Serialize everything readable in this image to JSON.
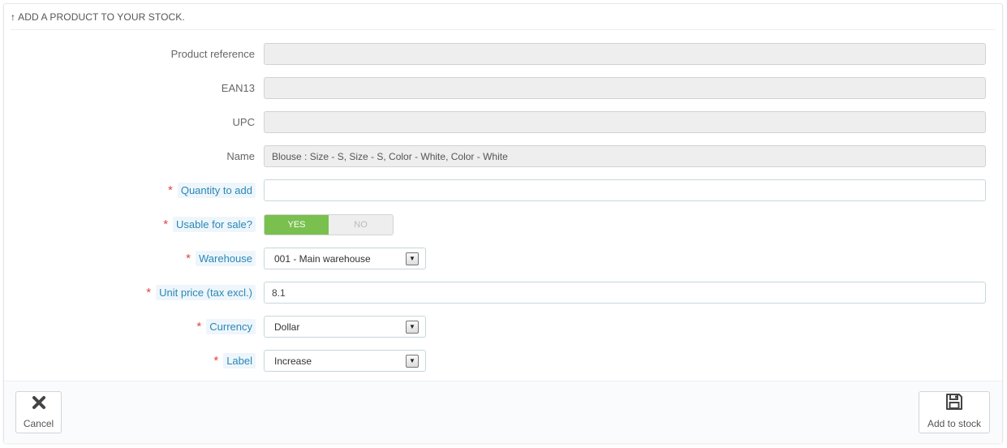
{
  "panel": {
    "heading_icon": "arrow-up-icon",
    "heading": "ADD A PRODUCT TO YOUR STOCK."
  },
  "form": {
    "product_reference": {
      "label": "Product reference",
      "value": ""
    },
    "ean13": {
      "label": "EAN13",
      "value": ""
    },
    "upc": {
      "label": "UPC",
      "value": ""
    },
    "name": {
      "label": "Name",
      "value": "Blouse : Size - S, Size - S, Color - White, Color - White"
    },
    "quantity": {
      "label": "Quantity to add",
      "value": "",
      "required": true
    },
    "usable": {
      "label": "Usable for sale?",
      "yes": "YES",
      "no": "NO",
      "selected": "YES",
      "required": true
    },
    "warehouse": {
      "label": "Warehouse",
      "value": "001 - Main warehouse",
      "required": true
    },
    "unit_price": {
      "label": "Unit price (tax excl.)",
      "value": "8.1",
      "required": true
    },
    "currency": {
      "label": "Currency",
      "value": "Dollar",
      "required": true
    },
    "stock_label": {
      "label": "Label",
      "value": "Increase",
      "required": true
    },
    "required_marker": "*"
  },
  "footer": {
    "cancel_label": "Cancel",
    "cancel_icon": "close-icon",
    "add_label": "Add to stock",
    "add_icon": "save-icon"
  },
  "colors": {
    "accent_label": "#2a87b5",
    "required": "#e04444",
    "switch_on": "#79c04f"
  }
}
